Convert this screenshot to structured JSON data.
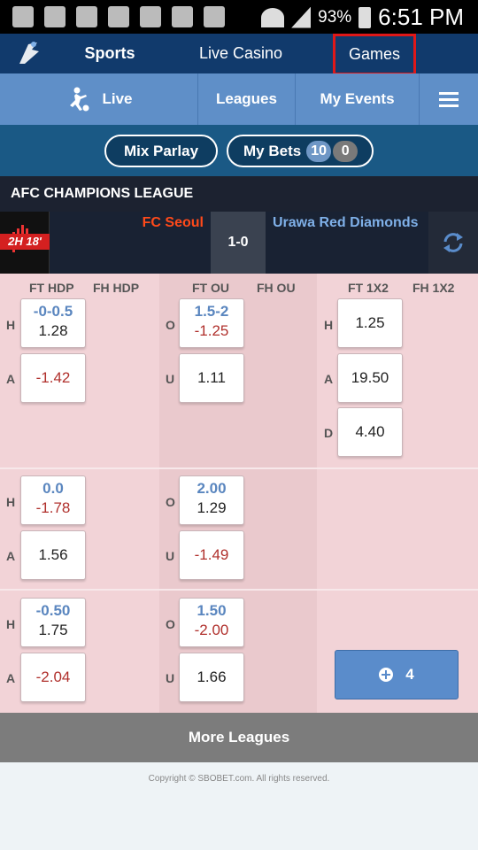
{
  "status_bar": {
    "battery": "93%",
    "time": "6:51 PM"
  },
  "nav": {
    "sports": "Sports",
    "live_casino": "Live Casino",
    "games": "Games"
  },
  "subnav": {
    "live": "Live",
    "leagues": "Leagues",
    "my_events": "My Events"
  },
  "betbar": {
    "mix_parlay": "Mix Parlay",
    "my_bets": "My Bets",
    "bets_count": "10",
    "pending_count": "0"
  },
  "league": {
    "name": "AFC CHAMPIONS LEAGUE"
  },
  "match": {
    "time": "2H 18'",
    "home": "FC Seoul",
    "score": "1-0",
    "away": "Urawa Red Diamonds"
  },
  "odds": {
    "headers": [
      "FT HDP",
      "FH HDP",
      "FT OU",
      "FH OU",
      "FT 1X2",
      "FH 1X2"
    ],
    "labels": {
      "h": "H",
      "a": "A",
      "o": "O",
      "u": "U",
      "d": "D"
    },
    "rows": [
      {
        "hdp": {
          "line": "-0-0.5",
          "home": "1.28",
          "away": "-1.42"
        },
        "ou": {
          "line": "1.5-2",
          "over": "-1.25",
          "under": "1.11"
        },
        "x12": {
          "home": "1.25",
          "away": "19.50",
          "draw": "4.40"
        }
      },
      {
        "hdp": {
          "line": "0.0",
          "home": "-1.78",
          "away": "1.56"
        },
        "ou": {
          "line": "2.00",
          "over": "1.29",
          "under": "-1.49"
        }
      },
      {
        "hdp": {
          "line": "-0.50",
          "home": "1.75",
          "away": "-2.04"
        },
        "ou": {
          "line": "1.50",
          "over": "-2.00",
          "under": "1.66"
        }
      }
    ],
    "more_count": "4"
  },
  "more_leagues": "More Leagues",
  "copyright": "Copyright © SBOBET.com. All rights reserved.",
  "colors": {
    "nav_bg": "#113a6c",
    "subnav_bg": "#5f8fc8",
    "highlight_border": "#e01818",
    "home_team": "#ff4a1a",
    "away_team": "#7fb0e8",
    "negative_odds": "#b0302c"
  }
}
